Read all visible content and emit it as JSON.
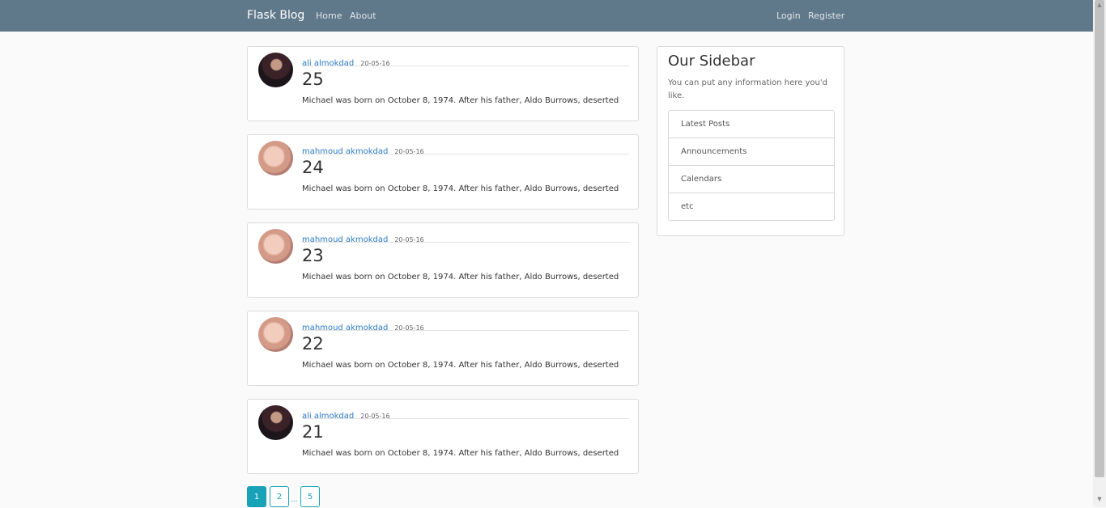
{
  "nav": {
    "brand": "Flask Blog",
    "left_links": [
      "Home",
      "About"
    ],
    "right_links": [
      "Login",
      "Register"
    ]
  },
  "posts": [
    {
      "author": "ali almokdad",
      "date": "20-05-16",
      "title": "25",
      "content": "Michael was born on October 8, 1974. After his father, Aldo Burrows, deserted",
      "avatar": "dark"
    },
    {
      "author": "mahmoud akmokdad",
      "date": "20-05-16",
      "title": "24",
      "content": "Michael was born on October 8, 1974. After his father, Aldo Burrows, deserted",
      "avatar": "light"
    },
    {
      "author": "mahmoud akmokdad",
      "date": "20-05-16",
      "title": "23",
      "content": "Michael was born on October 8, 1974. After his father, Aldo Burrows, deserted",
      "avatar": "light"
    },
    {
      "author": "mahmoud akmokdad",
      "date": "20-05-16",
      "title": "22",
      "content": "Michael was born on October 8, 1974. After his father, Aldo Burrows, deserted",
      "avatar": "light"
    },
    {
      "author": "ali almokdad",
      "date": "20-05-16",
      "title": "21",
      "content": "Michael was born on October 8, 1974. After his father, Aldo Burrows, deserted",
      "avatar": "dark"
    }
  ],
  "sidebar": {
    "title": "Our Sidebar",
    "text": "You can put any information here you'd like.",
    "items": [
      "Latest Posts",
      "Announcements",
      "Calendars",
      "etc"
    ]
  },
  "pagination": {
    "pages": [
      "1",
      "2",
      "5"
    ],
    "active": "1",
    "ellipsis": "..."
  },
  "colors": {
    "navbar": "#5f788a",
    "link": "#2a7bc8",
    "pagination": "#17a2b8",
    "background": "#fafafa"
  }
}
